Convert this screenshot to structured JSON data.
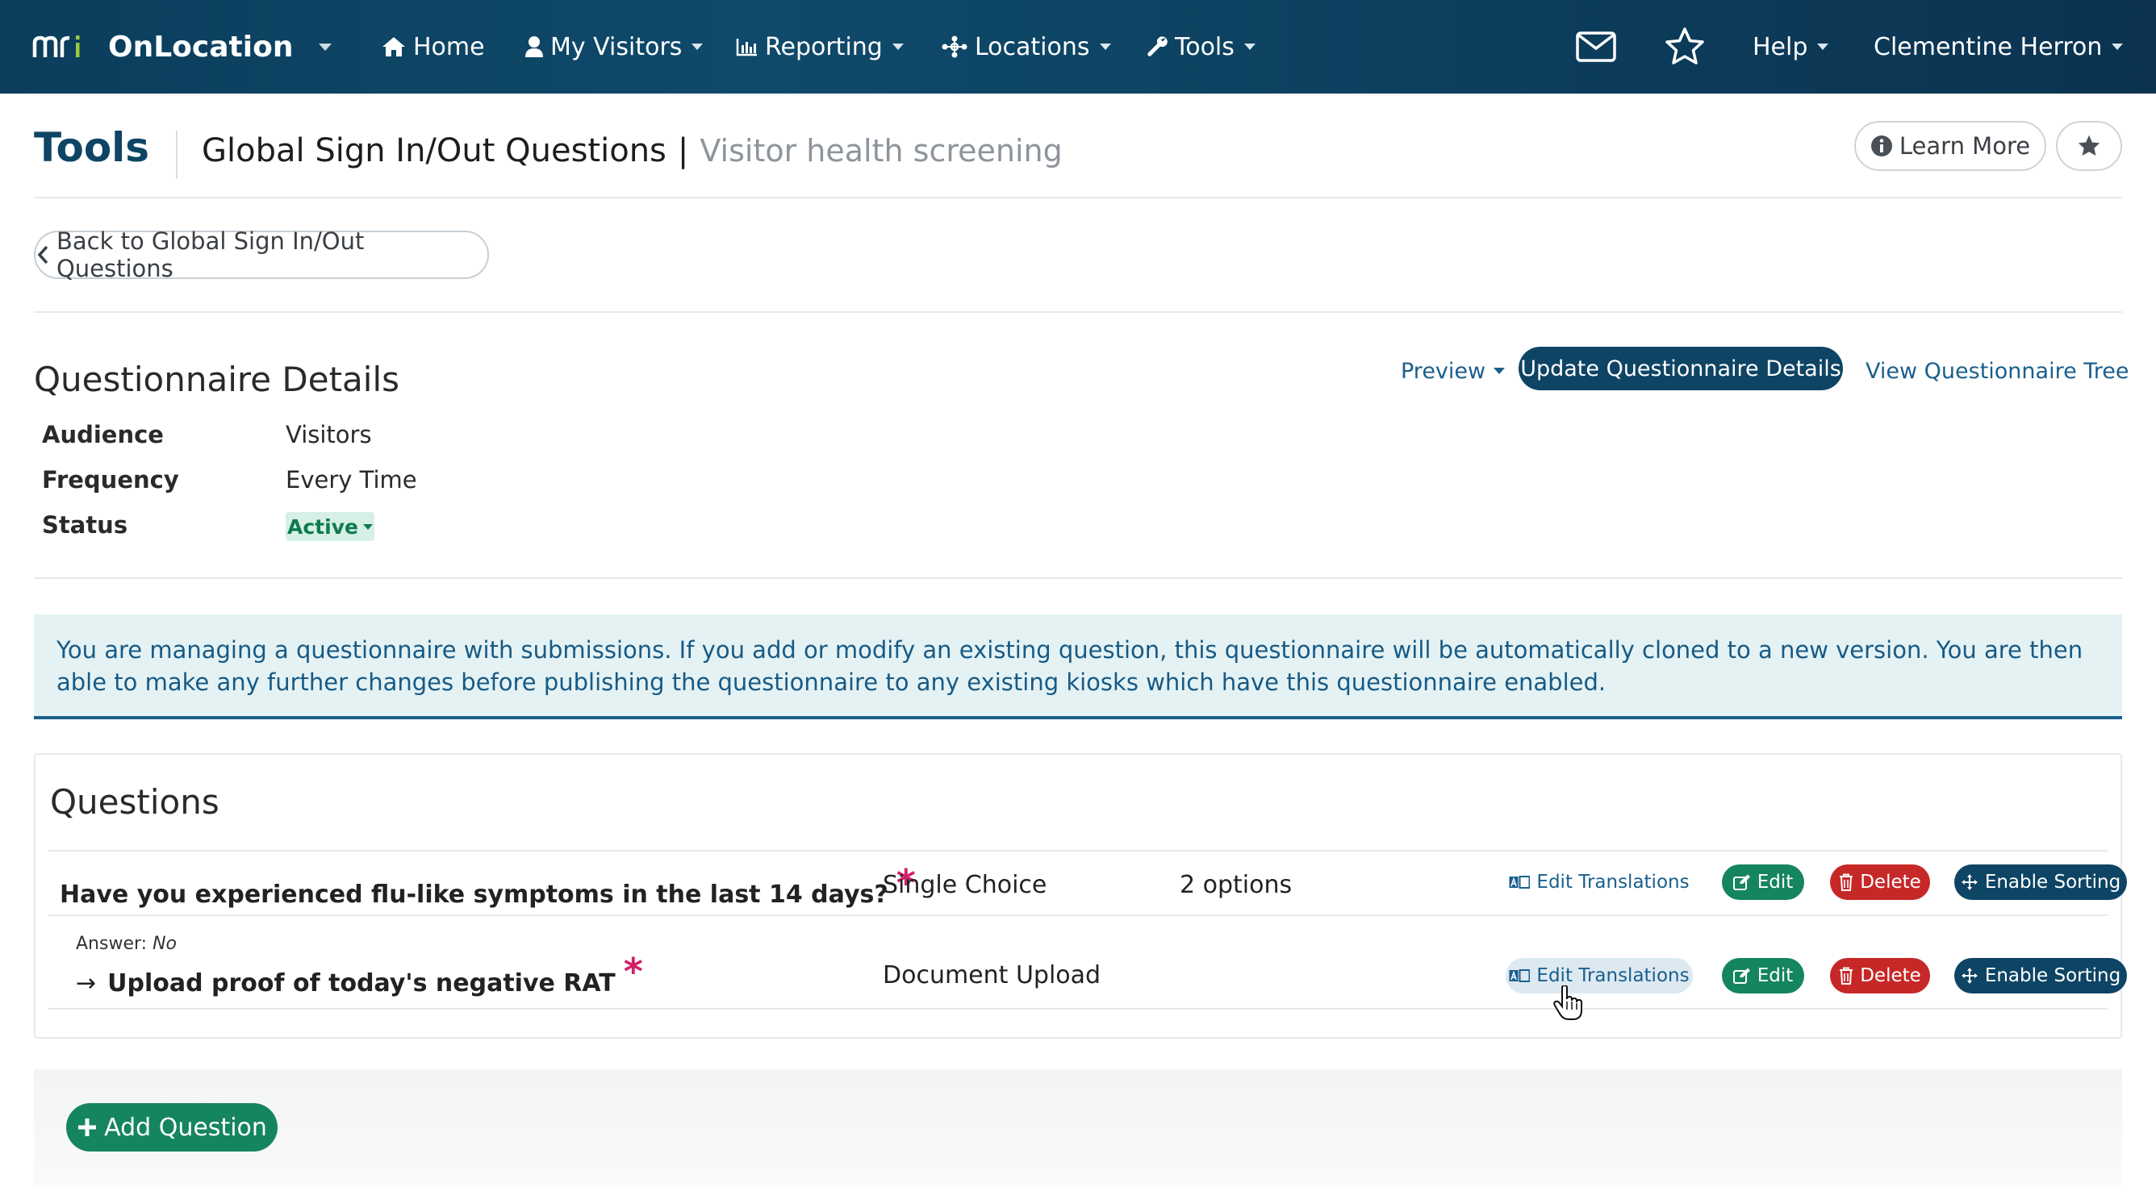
{
  "navbar": {
    "brand_mark": "mri",
    "brand_name": "OnLocation",
    "items": [
      {
        "label": "Home",
        "icon": "home-icon"
      },
      {
        "label": "My Visitors",
        "icon": "user-icon"
      },
      {
        "label": "Reporting",
        "icon": "bar-chart-icon"
      },
      {
        "label": "Locations",
        "icon": "network-icon"
      },
      {
        "label": "Tools",
        "icon": "wrench-icon"
      }
    ],
    "help_label": "Help",
    "user_name": "Clementine Herron"
  },
  "header": {
    "section": "Tools",
    "title": "Global Sign In/Out Questions",
    "separator": "|",
    "subtitle": "Visitor health screening",
    "learn_more_label": "Learn More"
  },
  "back_label": "Back to Global Sign In/Out Questions",
  "details": {
    "title": "Questionnaire Details",
    "preview_label": "Preview",
    "update_label": "Update Questionnaire Details",
    "tree_label": "View Questionnaire Tree",
    "fields": [
      {
        "label": "Audience",
        "value": "Visitors"
      },
      {
        "label": "Frequency",
        "value": "Every Time"
      },
      {
        "label": "Status",
        "value": "Active"
      }
    ]
  },
  "alert": {
    "text": "You are managing a questionnaire with submissions. If you add or modify an existing question, this questionnaire will be automatically cloned to a new version. You are then able to make any further changes before publishing the questionnaire to any existing kiosks which have this questionnaire enabled."
  },
  "questions": {
    "title": "Questions",
    "actions": {
      "translations": "Edit Translations",
      "edit": "Edit",
      "delete": "Delete",
      "sort": "Enable Sorting"
    },
    "rows": [
      {
        "text": "Have you experienced flu-like symptoms in the last 14 days?",
        "required_mark": "*",
        "type": "Single Choice",
        "options": "2 options"
      },
      {
        "answer_prefix": "Answer:",
        "answer_value": "No",
        "arrow": "→",
        "text": "Upload proof of today's negative RAT",
        "required_mark": "*",
        "type": "Document Upload",
        "options": ""
      }
    ],
    "add_label": "Add Question"
  },
  "colors": {
    "navbar": "#0f4a6b",
    "primary": "#0e4464",
    "success": "#14855f",
    "danger": "#c62828",
    "link": "#1a5f8d",
    "required": "#d0216a",
    "alert_bg": "#e4f2f4"
  }
}
